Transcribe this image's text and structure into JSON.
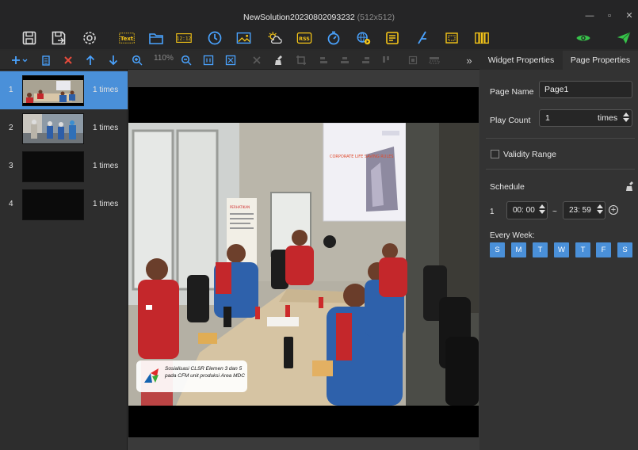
{
  "window": {
    "title": "NewSolution20230802093232",
    "resolution": "(512x512)",
    "minimize_glyph": "—",
    "maximize_glyph": "▫",
    "close_glyph": "✕"
  },
  "toolbar": {
    "text_label": "Text",
    "clock_label": "12:12",
    "rss_label": "RSS",
    "icons": [
      "save-icon",
      "save-as-icon",
      "settings-icon",
      "text-widget-icon",
      "folder-icon",
      "digital-clock-icon",
      "analog-clock-icon",
      "image-widget-icon",
      "weather-icon",
      "rss-icon",
      "timer-icon",
      "web-video-icon",
      "document-icon",
      "draw-icon",
      "window-icon",
      "color-bar-icon",
      "preview-eye-icon",
      "publish-send-icon"
    ]
  },
  "edit_toolbar": {
    "zoom_level": "110%",
    "more_glyph": "»"
  },
  "right_tabs": {
    "widget_properties": "Widget Properties",
    "page_properties": "Page Properties"
  },
  "pages": [
    {
      "num": "1",
      "times": "1  times",
      "thumb": "meeting"
    },
    {
      "num": "2",
      "times": "1  times",
      "thumb": "workers"
    },
    {
      "num": "3",
      "times": "1  times",
      "thumb": "empty"
    },
    {
      "num": "4",
      "times": "1  times",
      "thumb": "empty"
    }
  ],
  "canvas": {
    "caption": "Sosialisasi CLSR Elemen 3 dan 5 pada CFM unit produksi Area MDC",
    "screen_title": "CORPORATE LIFE SAVING RULES"
  },
  "page_properties": {
    "page_name_label": "Page Name",
    "page_name_value": "Page1",
    "play_count_label": "Play Count",
    "play_count_value": "1",
    "play_count_unit": "times",
    "validity_range_label": "Validity Range",
    "schedule_label": "Schedule",
    "schedule_index": "1",
    "start_time": "00: 00",
    "tilde": "~",
    "end_time": "23: 59",
    "add_glyph": "+",
    "every_week_label": "Every Week:",
    "days": [
      "S",
      "M",
      "T",
      "W",
      "T",
      "F",
      "S"
    ]
  },
  "colors": {
    "accent": "#4a90d9",
    "toolbar_blue": "#4aa3ff",
    "icon_yellow": "#f5c518",
    "green": "#37c24a",
    "delete_red": "#e84b3c"
  }
}
